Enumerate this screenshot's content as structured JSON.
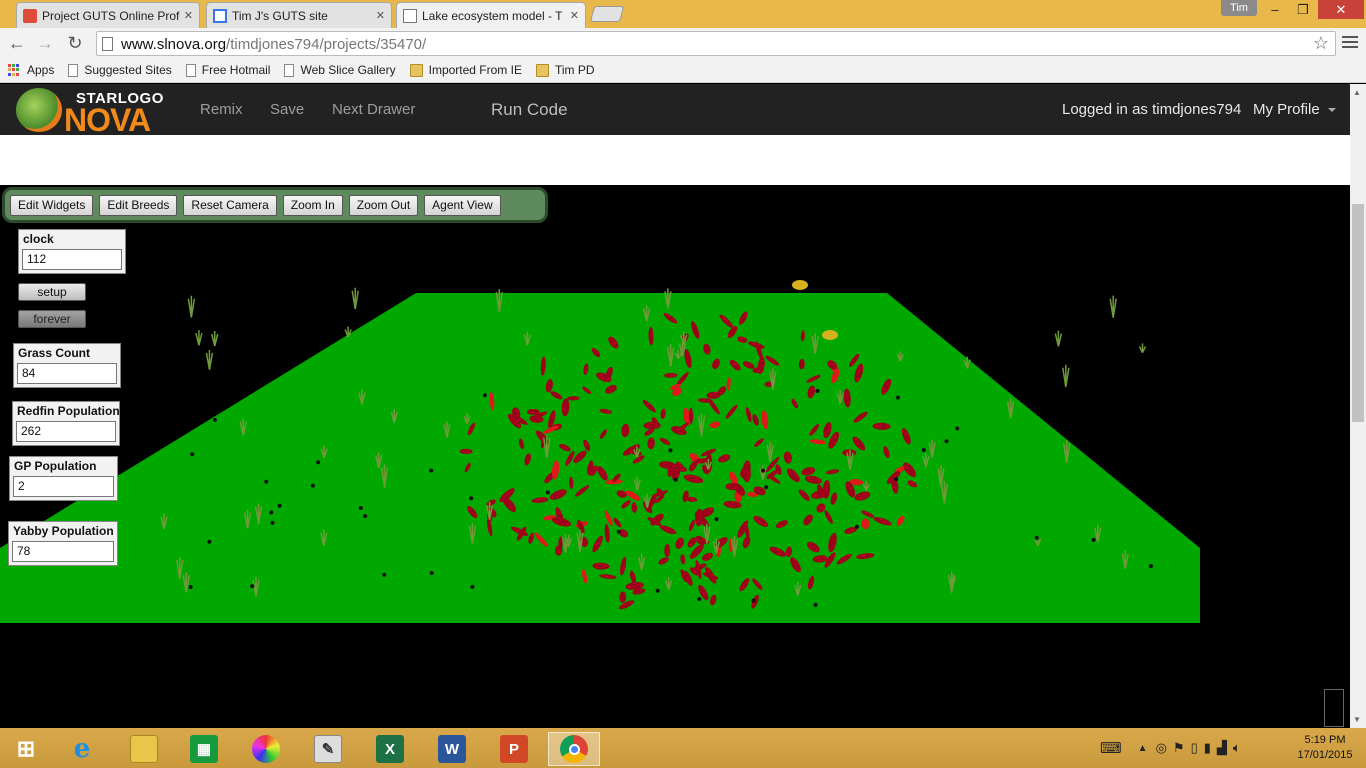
{
  "browser": {
    "tabs": [
      {
        "title": "Project GUTS Online Profe",
        "icon": "google-plus-icon",
        "active": false
      },
      {
        "title": "Tim J's GUTS site",
        "icon": "sites-icon",
        "active": false
      },
      {
        "title": "Lake ecosystem model - T",
        "icon": "page-icon",
        "active": true
      }
    ],
    "user": "Tim",
    "url_host": "www.slnova.org",
    "url_path": "/timdjones794/projects/35470/",
    "bookmarks": [
      "Apps",
      "Suggested Sites",
      "Free Hotmail",
      "Web Slice Gallery",
      "Imported From IE",
      "Tim PD"
    ]
  },
  "app": {
    "logo_top": "STARLOGO",
    "logo_bottom": "NOVA",
    "nav": {
      "remix": "Remix",
      "save": "Save",
      "next_drawer": "Next Drawer",
      "run_code": "Run Code",
      "logged_in": "Logged in as timdjones794",
      "my_profile": "My Profile"
    },
    "toolbar": {
      "edit_widgets": "Edit Widgets",
      "edit_breeds": "Edit Breeds",
      "reset_camera": "Reset Camera",
      "zoom_in": "Zoom In",
      "zoom_out": "Zoom Out",
      "agent_view": "Agent View"
    },
    "widgets": {
      "clock": {
        "label": "clock",
        "value": "112"
      },
      "setup": "setup",
      "forever": "forever",
      "grass_count": {
        "label": "Grass Count",
        "value": "84"
      },
      "redfin_population": {
        "label": "Redfin Population",
        "value": "262"
      },
      "gp_population": {
        "label": "GP Population",
        "value": "2"
      },
      "yabby_population": {
        "label": "Yabby Population",
        "value": "78"
      }
    },
    "colors": {
      "terrain": "#00a800",
      "redfin": "#a0001a",
      "nav_bg": "#222222",
      "widget_bar": "#5e8a5e"
    }
  },
  "taskbar": {
    "time": "5:19 PM",
    "date": "17/01/2015",
    "apps": [
      "start-icon",
      "ie-icon",
      "file-explorer-icon",
      "store-icon",
      "paint-icon",
      "notepad-icon",
      "excel-icon",
      "word-icon",
      "powerpoint-icon",
      "chrome-icon"
    ]
  }
}
